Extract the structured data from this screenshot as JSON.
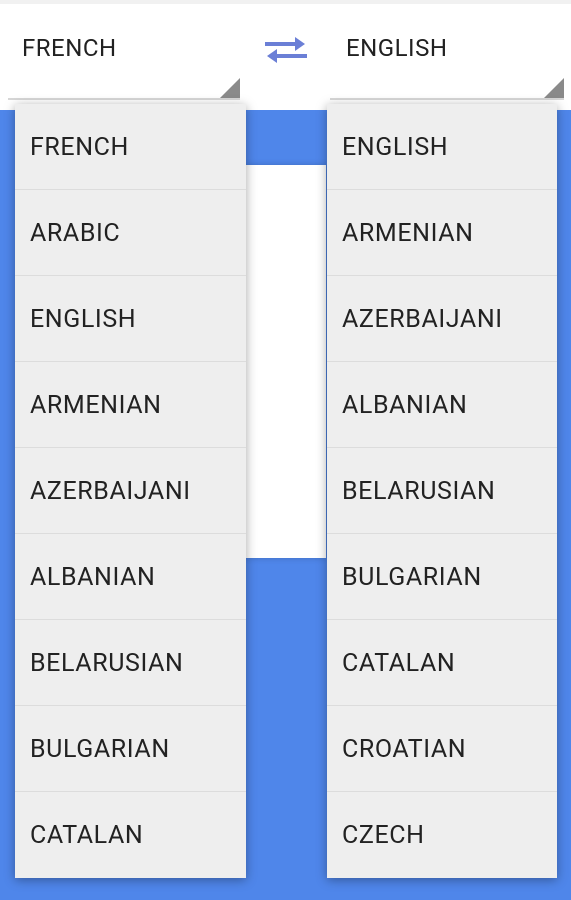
{
  "source_spinner": {
    "selected": "FRENCH"
  },
  "target_spinner": {
    "selected": "ENGLISH"
  },
  "swap_button": {
    "icon": "swap-arrows-icon",
    "color": "#6b7fd6"
  },
  "source_dropdown": {
    "items": [
      {
        "label": "FRENCH"
      },
      {
        "label": "ARABIC"
      },
      {
        "label": "ENGLISH"
      },
      {
        "label": "ARMENIAN"
      },
      {
        "label": "AZERBAIJANI"
      },
      {
        "label": "ALBANIAN"
      },
      {
        "label": "BELARUSIAN"
      },
      {
        "label": "BULGARIAN"
      },
      {
        "label": "CATALAN"
      }
    ]
  },
  "target_dropdown": {
    "items": [
      {
        "label": "ENGLISH"
      },
      {
        "label": "ARMENIAN"
      },
      {
        "label": "AZERBAIJANI"
      },
      {
        "label": "ALBANIAN"
      },
      {
        "label": "BELARUSIAN"
      },
      {
        "label": "BULGARIAN"
      },
      {
        "label": "CATALAN"
      },
      {
        "label": "CROATIAN"
      },
      {
        "label": "CZECH"
      }
    ]
  },
  "colors": {
    "accent_blue": "#4f86ea",
    "dropdown_bg": "#eeeeee"
  }
}
